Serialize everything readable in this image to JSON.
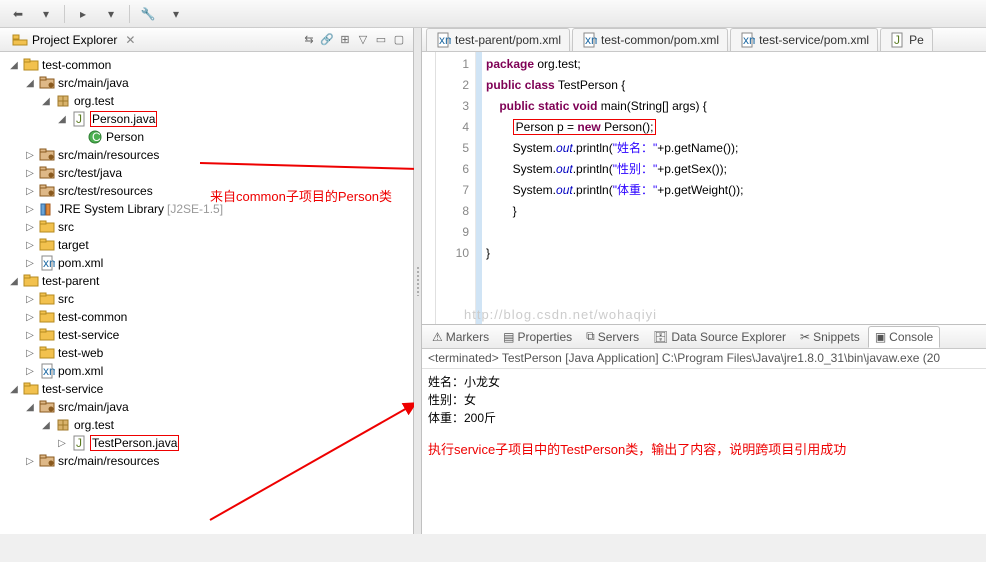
{
  "topbar": {
    "items": [
      "back",
      "fwd",
      "open",
      "sep",
      "run",
      "sep",
      "debug"
    ]
  },
  "left": {
    "view_title": "Project Explorer",
    "toolbar_icons": [
      "collapse",
      "link",
      "menu",
      "min",
      "max"
    ],
    "tree": {
      "projects": [
        {
          "name": "test-common",
          "expanded": true,
          "children": [
            {
              "name": "src/main/java",
              "type": "srcfolder",
              "expanded": true,
              "children": [
                {
                  "name": "org.test",
                  "type": "package",
                  "expanded": true,
                  "children": [
                    {
                      "name": "Person.java",
                      "type": "cu",
                      "expanded": true,
                      "hl": true,
                      "children": [
                        {
                          "name": "Person",
                          "type": "class"
                        }
                      ]
                    }
                  ]
                }
              ]
            },
            {
              "name": "src/main/resources",
              "type": "srcfolder"
            },
            {
              "name": "src/test/java",
              "type": "srcfolder"
            },
            {
              "name": "src/test/resources",
              "type": "srcfolder"
            },
            {
              "name": "JRE System Library",
              "extra": "[J2SE-1.5]",
              "type": "library"
            },
            {
              "name": "src",
              "type": "folder"
            },
            {
              "name": "target",
              "type": "folder"
            },
            {
              "name": "pom.xml",
              "type": "xml"
            }
          ]
        },
        {
          "name": "test-parent",
          "expanded": true,
          "children": [
            {
              "name": "src",
              "type": "folder"
            },
            {
              "name": "test-common",
              "type": "folder"
            },
            {
              "name": "test-service",
              "type": "folder"
            },
            {
              "name": "test-web",
              "type": "folder"
            },
            {
              "name": "pom.xml",
              "type": "xml"
            }
          ]
        },
        {
          "name": "test-service",
          "expanded": true,
          "children": [
            {
              "name": "src/main/java",
              "type": "srcfolder",
              "expanded": true,
              "children": [
                {
                  "name": "org.test",
                  "type": "package",
                  "expanded": true,
                  "children": [
                    {
                      "name": "TestPerson.java",
                      "type": "cu",
                      "hl": true
                    }
                  ]
                }
              ]
            },
            {
              "name": "src/main/resources",
              "type": "srcfolder"
            }
          ]
        }
      ]
    }
  },
  "annotations": {
    "a1": "来自common子项目的Person类",
    "a2": "执行service子项目中的TestPerson类，输出了内容，说明跨项目引用成功"
  },
  "editor": {
    "tabs": [
      {
        "label": "test-parent/pom.xml",
        "icon": "xml"
      },
      {
        "label": "test-common/pom.xml",
        "icon": "xml"
      },
      {
        "label": "test-service/pom.xml",
        "icon": "xml"
      },
      {
        "label": "Pe",
        "icon": "java",
        "cut": true
      }
    ],
    "code": {
      "lines": [
        "1",
        "2",
        "3",
        "4",
        "5",
        "6",
        "7",
        "8",
        "9",
        "10"
      ],
      "l1_kw1": "package",
      "l1_rest": " org.test;",
      "l2_kw1": "public",
      "l2_kw2": "class",
      "l2_rest": " TestPerson {",
      "l3_kw1": "public",
      "l3_kw2": "static",
      "l3_kw3": "void",
      "l3_rest": " main(String[] args) {",
      "l4_a": "Person p = ",
      "l4_kw": "new",
      "l4_b": " Person();",
      "l5_a": "System.",
      "l5_fld": "out",
      "l5_b": ".println(",
      "l5_str": "\"姓名：\"",
      "l5_c": "+p.getName());",
      "l6_a": "System.",
      "l6_fld": "out",
      "l6_b": ".println(",
      "l6_str": "\"性别：\"",
      "l6_c": "+p.getSex());",
      "l7_a": "System.",
      "l7_fld": "out",
      "l7_b": ".println(",
      "l7_str": "\"体重：\"",
      "l7_c": "+p.getWeight());",
      "l8": "        }",
      "l9": "",
      "l10": "}"
    },
    "watermark": "http://blog.csdn.net/wohaqiyi"
  },
  "bottom": {
    "tabs": [
      "Markers",
      "Properties",
      "Servers",
      "Data Source Explorer",
      "Snippets",
      "Console"
    ],
    "active_tab": 5,
    "console_sub": "<terminated> TestPerson [Java Application] C:\\Program Files\\Java\\jre1.8.0_31\\bin\\javaw.exe (20",
    "output": [
      "姓名：小龙女",
      "性别：女",
      "体重：200斤"
    ]
  }
}
